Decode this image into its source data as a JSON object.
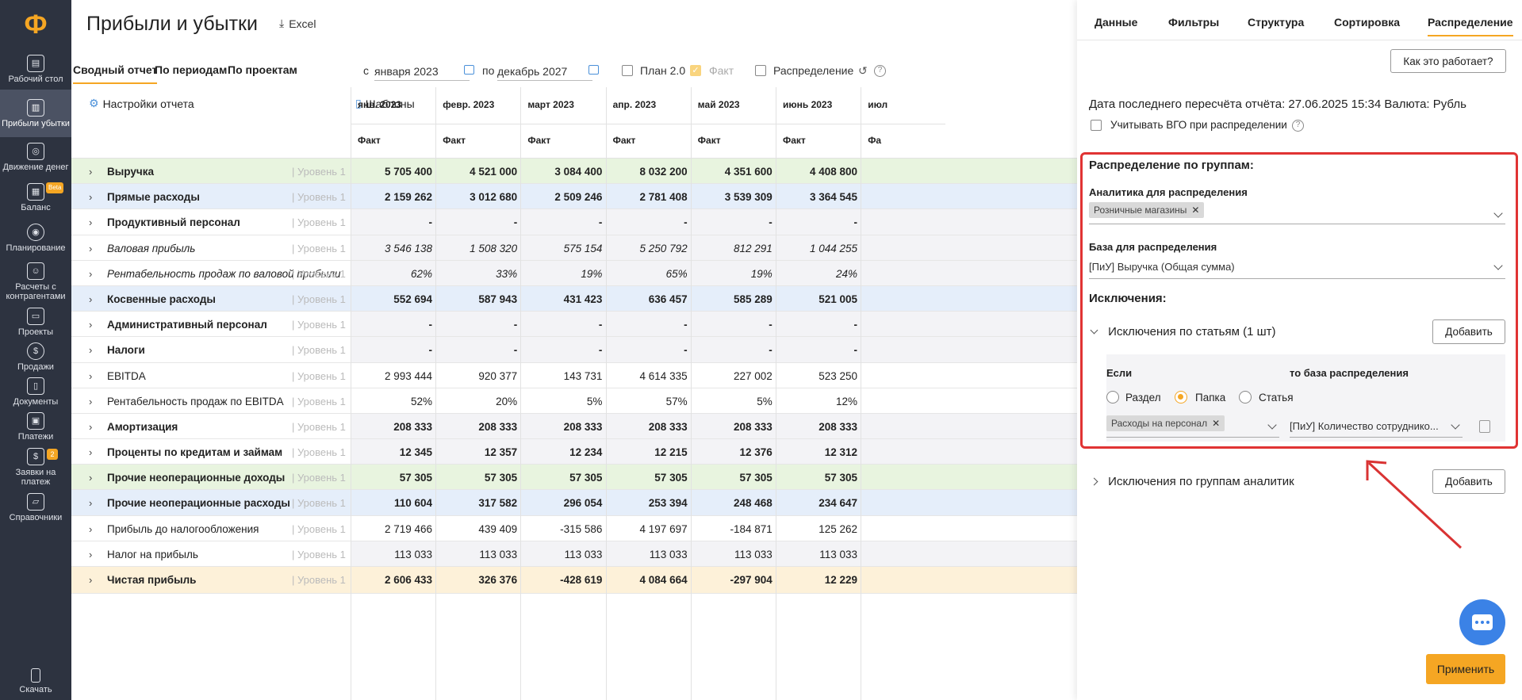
{
  "sidebar": {
    "logo": "Ф",
    "items": [
      {
        "label": "Рабочий стол",
        "icon": "desktop-icon",
        "glyph": "▤"
      },
      {
        "label": "Прибыли убытки",
        "icon": "chart-icon",
        "glyph": "▥"
      },
      {
        "label": "Движение денег",
        "icon": "coins-icon",
        "glyph": "◎"
      },
      {
        "label": "Баланс",
        "icon": "balance-icon",
        "glyph": "▦",
        "badge": "Beta"
      },
      {
        "label": "Планирование",
        "icon": "target-icon",
        "glyph": "◉"
      },
      {
        "label": "Расчеты с контрагентами",
        "icon": "people-icon",
        "glyph": "☺"
      },
      {
        "label": "Проекты",
        "icon": "briefcase-icon",
        "glyph": "▭"
      },
      {
        "label": "Продажи",
        "icon": "dollar-icon",
        "glyph": "$"
      },
      {
        "label": "Документы",
        "icon": "documents-icon",
        "glyph": "▯"
      },
      {
        "label": "Платежи",
        "icon": "wallet-icon",
        "glyph": "▣"
      },
      {
        "label": "Заявки на платеж",
        "icon": "request-icon",
        "glyph": "$",
        "badge": "2"
      },
      {
        "label": "Справочники",
        "icon": "folder-icon",
        "glyph": "▱"
      }
    ],
    "bottom_label": "Скачать"
  },
  "header": {
    "title": "Прибыли и убытки",
    "excel_label": "Excel"
  },
  "toolbar": {
    "tabs": [
      "Сводный отчет",
      "По периодам",
      "По проектам"
    ],
    "from_label": "с",
    "from_value": "января 2023",
    "to_label": "по",
    "to_value": "декабрь 2027",
    "plan_label": "План 2.0",
    "fact_label": "Факт",
    "distribution_label": "Распределение",
    "help": "?"
  },
  "table": {
    "settings_label": "Настройки отчета",
    "templates_label": "Шаблоны",
    "months": [
      "янв. 2023",
      "февр. 2023",
      "март 2023",
      "апр. 2023",
      "май 2023",
      "июнь 2023",
      "июл"
    ],
    "fact_label": "Факт",
    "fact_label_short": "Фа",
    "rows": [
      {
        "name": "Выручка",
        "level": "| Уровень 1",
        "style": "green bold",
        "values": [
          "5 705 400",
          "4 521 000",
          "3 084 400",
          "8 032 200",
          "4 351 600",
          "4 408 800"
        ]
      },
      {
        "name": "Прямые расходы",
        "level": "| Уровень 1",
        "style": "blue bold",
        "values": [
          "2 159 262",
          "3 012 680",
          "2 509 246",
          "2 781 408",
          "3 539 309",
          "3 364 545"
        ]
      },
      {
        "name": "Продуктивный персонал",
        "level": "| Уровень 1",
        "style": "plain bold",
        "values": [
          "-",
          "-",
          "-",
          "-",
          "-",
          "-"
        ]
      },
      {
        "name": "Валовая прибыль",
        "level": "| Уровень 1",
        "style": "italic",
        "values": [
          "3 546 138",
          "1 508 320",
          "575 154",
          "5 250 792",
          "812 291",
          "1 044 255"
        ]
      },
      {
        "name": "Рентабельность продаж по валовой прибыли",
        "level": "| Уровень 1",
        "style": "italic",
        "values": [
          "62%",
          "33%",
          "19%",
          "65%",
          "19%",
          "24%"
        ]
      },
      {
        "name": "Косвенные расходы",
        "level": "| Уровень 1",
        "style": "blue bold",
        "values": [
          "552 694",
          "587 943",
          "431 423",
          "636 457",
          "585 289",
          "521 005"
        ]
      },
      {
        "name": "Административный персонал",
        "level": "| Уровень 1",
        "style": "plain bold",
        "values": [
          "-",
          "-",
          "-",
          "-",
          "-",
          "-"
        ]
      },
      {
        "name": "Налоги",
        "level": "| Уровень 1",
        "style": "plain bold",
        "values": [
          "-",
          "-",
          "-",
          "-",
          "-",
          "-"
        ]
      },
      {
        "name": "EBITDA",
        "level": "| Уровень 1",
        "style": "white",
        "values": [
          "2 993 444",
          "920 377",
          "143 731",
          "4 614 335",
          "227 002",
          "523 250"
        ]
      },
      {
        "name": "Рентабельность продаж по EBITDA",
        "level": "| Уровень 1",
        "style": "white",
        "values": [
          "52%",
          "20%",
          "5%",
          "57%",
          "5%",
          "12%"
        ]
      },
      {
        "name": "Амортизация",
        "level": "| Уровень 1",
        "style": "plain bold",
        "values": [
          "208 333",
          "208 333",
          "208 333",
          "208 333",
          "208 333",
          "208 333"
        ]
      },
      {
        "name": "Проценты по кредитам и займам",
        "level": "| Уровень 1",
        "style": "plain bold",
        "values": [
          "12 345",
          "12 357",
          "12 234",
          "12 215",
          "12 376",
          "12 312"
        ]
      },
      {
        "name": "Прочие неоперационные доходы",
        "level": "| Уровень 1",
        "style": "green bold",
        "values": [
          "57 305",
          "57 305",
          "57 305",
          "57 305",
          "57 305",
          "57 305"
        ]
      },
      {
        "name": "Прочие неоперационные расходы",
        "level": "| Уровень 1",
        "style": "blue bold",
        "values": [
          "110 604",
          "317 582",
          "296 054",
          "253 394",
          "248 468",
          "234 647"
        ]
      },
      {
        "name": "Прибыль до налогообложения",
        "level": "| Уровень 1",
        "style": "white",
        "values": [
          "2 719 466",
          "439 409",
          "-315 586",
          "4 197 697",
          "-184 871",
          "125 262"
        ]
      },
      {
        "name": "Налог на прибыль",
        "level": "| Уровень 1",
        "style": "plain",
        "values": [
          "113 033",
          "113 033",
          "113 033",
          "113 033",
          "113 033",
          "113 033"
        ]
      },
      {
        "name": "Чистая прибыль",
        "level": "| Уровень 1",
        "style": "yellow bold",
        "values": [
          "2 606 433",
          "326 376",
          "-428 619",
          "4 084 664",
          "-297 904",
          "12 229"
        ]
      }
    ]
  },
  "panel": {
    "tabs": [
      "Данные",
      "Фильтры",
      "Структура",
      "Сортировка",
      "Распределение"
    ],
    "how_it_works": "Как это работает?",
    "recalc_text": "Дата последнего пересчёта отчёта: 27.06.2025 15:34 Валюта: Рубль",
    "vgo_label": "Учитывать ВГО при распределении",
    "groups_title": "Распределение по группам:",
    "analytics_label": "Аналитика для распределения",
    "analytics_chip": "Розничные магазины",
    "base_label": "База для распределения",
    "base_value": "[ПиУ] Выручка (Общая сумма)",
    "exceptions_title": "Исключения:",
    "exc_articles_label": "Исключения по статьям (1 шт)",
    "add_label": "Добавить",
    "if_label": "Если",
    "then_label": "то база распределения",
    "radio_options": [
      "Раздел",
      "Папка",
      "Статья"
    ],
    "radio_selected": "Папка",
    "folder_chip": "Расходы на персонал",
    "then_value": "[ПиУ] Количество сотруднико...",
    "exc_groups_label": "Исключения по группам аналитик",
    "apply_label": "Применить"
  }
}
